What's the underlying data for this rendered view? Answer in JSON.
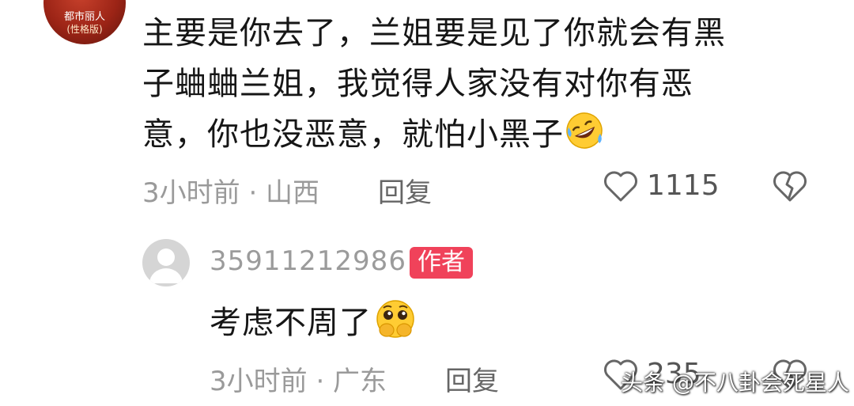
{
  "top_comment": {
    "avatar_text_line1": "都市丽人",
    "avatar_text_line2": "(性格版)",
    "text_line1": "主要是你去了，兰姐要是见了你就会有黑",
    "text_line2": "子蛐蛐兰姐，我觉得人家没有对你有恶",
    "text_line3": "意，你也没恶意，就怕小黑子",
    "emoji_icon": "rolling-laughing-emoji",
    "meta": "3小时前 · 山西",
    "reply_label": "回复",
    "like_count": "1115",
    "like_icon": "heart-outline-icon",
    "dislike_icon": "broken-heart-icon"
  },
  "reply_comment": {
    "username": "35911212986",
    "badge": "作者",
    "text": "考虑不周了",
    "emoji_icon": "pleading-face-emoji",
    "meta": "3小时前 · 广东",
    "reply_label": "回复",
    "like_count": "235",
    "like_icon": "heart-outline-icon",
    "dislike_icon": "broken-heart-icon"
  },
  "watermark": "头条 @不八卦会死星人",
  "colors": {
    "badge": "#f0425a",
    "meta_gray": "#9a9a9a"
  }
}
